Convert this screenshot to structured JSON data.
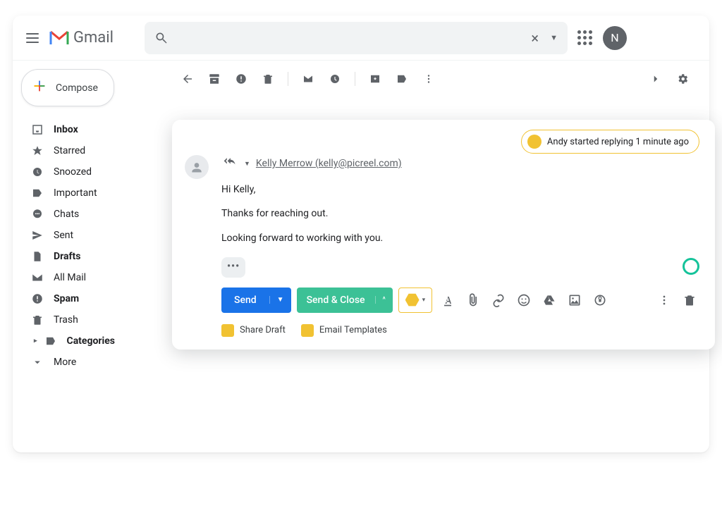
{
  "header": {
    "app_name": "Gmail",
    "search_placeholder": "",
    "avatar_initial": "N"
  },
  "compose_button_label": "Compose",
  "sidebar": {
    "items": [
      {
        "label": "Inbox",
        "bold": true,
        "icon": "inbox"
      },
      {
        "label": "Starred",
        "bold": false,
        "icon": "star"
      },
      {
        "label": "Snoozed",
        "bold": false,
        "icon": "clock"
      },
      {
        "label": "Important",
        "bold": false,
        "icon": "tag"
      },
      {
        "label": "Chats",
        "bold": false,
        "icon": "chat"
      },
      {
        "label": "Sent",
        "bold": false,
        "icon": "send"
      },
      {
        "label": "Drafts",
        "bold": true,
        "icon": "file"
      },
      {
        "label": "All Mail",
        "bold": false,
        "icon": "mail"
      },
      {
        "label": "Spam",
        "bold": true,
        "icon": "spam"
      },
      {
        "label": "Trash",
        "bold": false,
        "icon": "trash"
      },
      {
        "label": "Categories",
        "bold": true,
        "icon": "label",
        "expandable": true
      },
      {
        "label": "More",
        "bold": false,
        "icon": "chevdown"
      }
    ]
  },
  "pill_text": "Andy started replying 1 minute ago",
  "recipient": "Kelly Merrow (kelly@picreel.com)",
  "message": {
    "line1": "Hi Kelly,",
    "line2": "Thanks for reaching out.",
    "line3": "Looking forward to working with you."
  },
  "actions": {
    "send": "Send",
    "send_close": "Send & Close",
    "share_draft": "Share Draft",
    "email_templates": "Email Templates"
  }
}
